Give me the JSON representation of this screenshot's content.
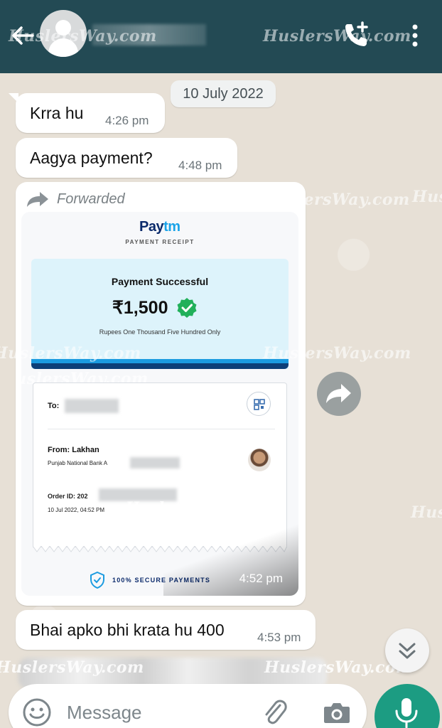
{
  "header": {
    "back_icon": "arrow-left-icon",
    "contact_name": "",
    "watermark_left": "HuslersWay.com",
    "watermark_right": "HuslersWay.com",
    "add_call_icon": "phone-plus-icon",
    "menu_icon": "more-vertical-icon",
    "color": "#234a54"
  },
  "date_chip": "10 July 2022",
  "messages": [
    {
      "text": "Krra hu",
      "time": "4:26 pm"
    },
    {
      "text": "Aagya payment?",
      "time": "4:48 pm"
    }
  ],
  "forwarded": {
    "label": "Forwarded",
    "time": "4:52 pm",
    "receipt": {
      "brand_a": "Pay",
      "brand_b": "tm",
      "title": "PAYMENT RECEIPT",
      "status": "Payment Successful",
      "amount": "₹1,500",
      "amount_words": "Rupees One Thousand Five Hundred Only",
      "to_label": "To:",
      "from_label": "From: Lakhan",
      "bank": "Punjab National Bank A",
      "order_id": "Order ID: 202",
      "datetime": "10 Jul 2022, 04:52 PM",
      "secure": "100% SECURE PAYMENTS",
      "colors": {
        "success_bg": "#ddf3fb",
        "accent": "#1b9be0",
        "dark": "#0c3f78"
      }
    }
  },
  "watermarks": [
    "HuslersWay.com",
    "HuslersWay.com",
    "HuslersWay.com",
    "HuslersWay.com",
    "HuslersWay.com",
    "Husl",
    "Hus",
    "HuslersWay.com",
    "HuslersWay.com"
  ],
  "last_message": {
    "text": "Bhai apko bhi krata hu 400",
    "time": "4:53 pm"
  },
  "input": {
    "placeholder": "Message",
    "value": ""
  },
  "icons": {
    "share": "forward-icon",
    "scroll": "double-chevron-down-icon",
    "emoji": "emoji-icon",
    "attach": "paperclip-icon",
    "camera": "camera-icon",
    "mic": "microphone-icon"
  },
  "accent_color": "#1c9c82"
}
